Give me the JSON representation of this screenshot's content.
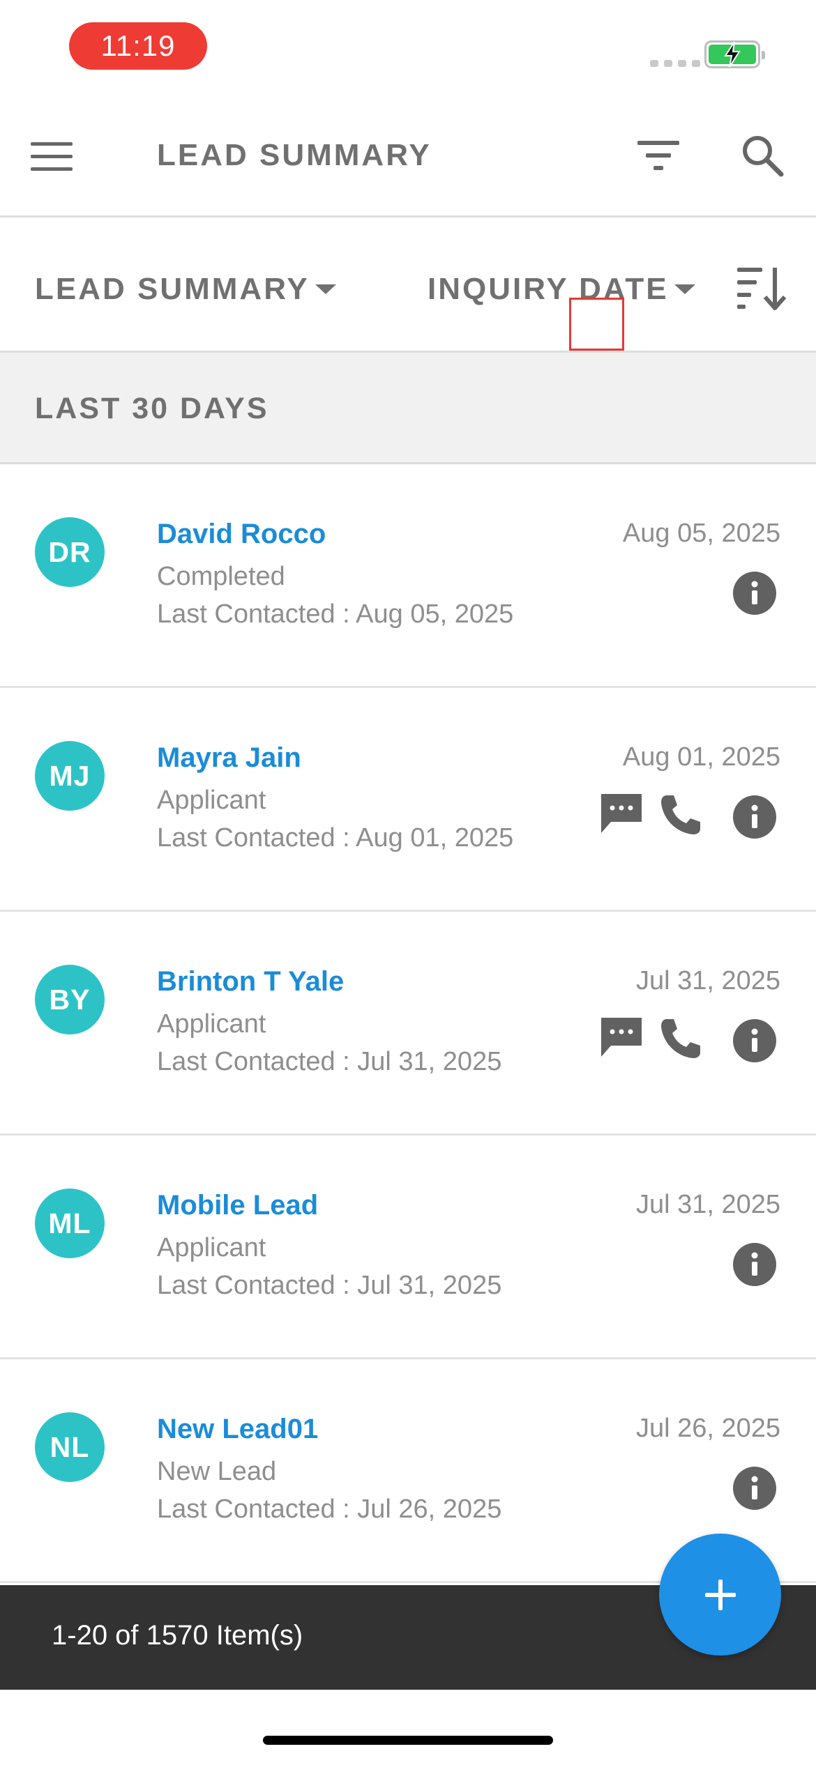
{
  "status_bar": {
    "time": "11:19"
  },
  "header": {
    "title": "LEAD SUMMARY"
  },
  "sortbar": {
    "view_label": "LEAD SUMMARY",
    "sort_label": "INQUIRY DATE"
  },
  "section": {
    "title": "LAST 30 DAYS"
  },
  "leads": [
    {
      "initials": "DR",
      "name": "David Rocco",
      "status": "Completed",
      "last_contacted": "Last Contacted : Aug 05, 2025",
      "date": "Aug 05, 2025",
      "actions": [
        "info-icon"
      ]
    },
    {
      "initials": "MJ",
      "name": "Mayra Jain",
      "status": "Applicant",
      "last_contacted": "Last Contacted : Aug 01, 2025",
      "date": "Aug 01, 2025",
      "actions": [
        "message-icon",
        "phone-icon",
        "info-icon"
      ]
    },
    {
      "initials": "BY",
      "name": "Brinton T Yale",
      "status": "Applicant",
      "last_contacted": "Last Contacted : Jul 31, 2025",
      "date": "Jul 31, 2025",
      "actions": [
        "message-icon",
        "phone-icon",
        "info-icon"
      ]
    },
    {
      "initials": "ML",
      "name": "Mobile Lead",
      "status": "Applicant",
      "last_contacted": "Last Contacted : Jul 31, 2025",
      "date": "Jul 31, 2025",
      "actions": [
        "info-icon"
      ]
    },
    {
      "initials": "NL",
      "name": "New Lead01",
      "status": "New Lead",
      "last_contacted": "Last Contacted : Jul 26, 2025",
      "date": "Jul 26, 2025",
      "actions": [
        "info-icon"
      ]
    }
  ],
  "footer": {
    "pagination": "1-20 of 1570 Item(s)"
  },
  "colors": {
    "accent": "#1e90e6",
    "avatar": "#2dc3c6",
    "name_link": "#1a8cd8",
    "snackbar": "#323232",
    "time_pill": "#ee3b34",
    "focus_box": "#e53935"
  }
}
